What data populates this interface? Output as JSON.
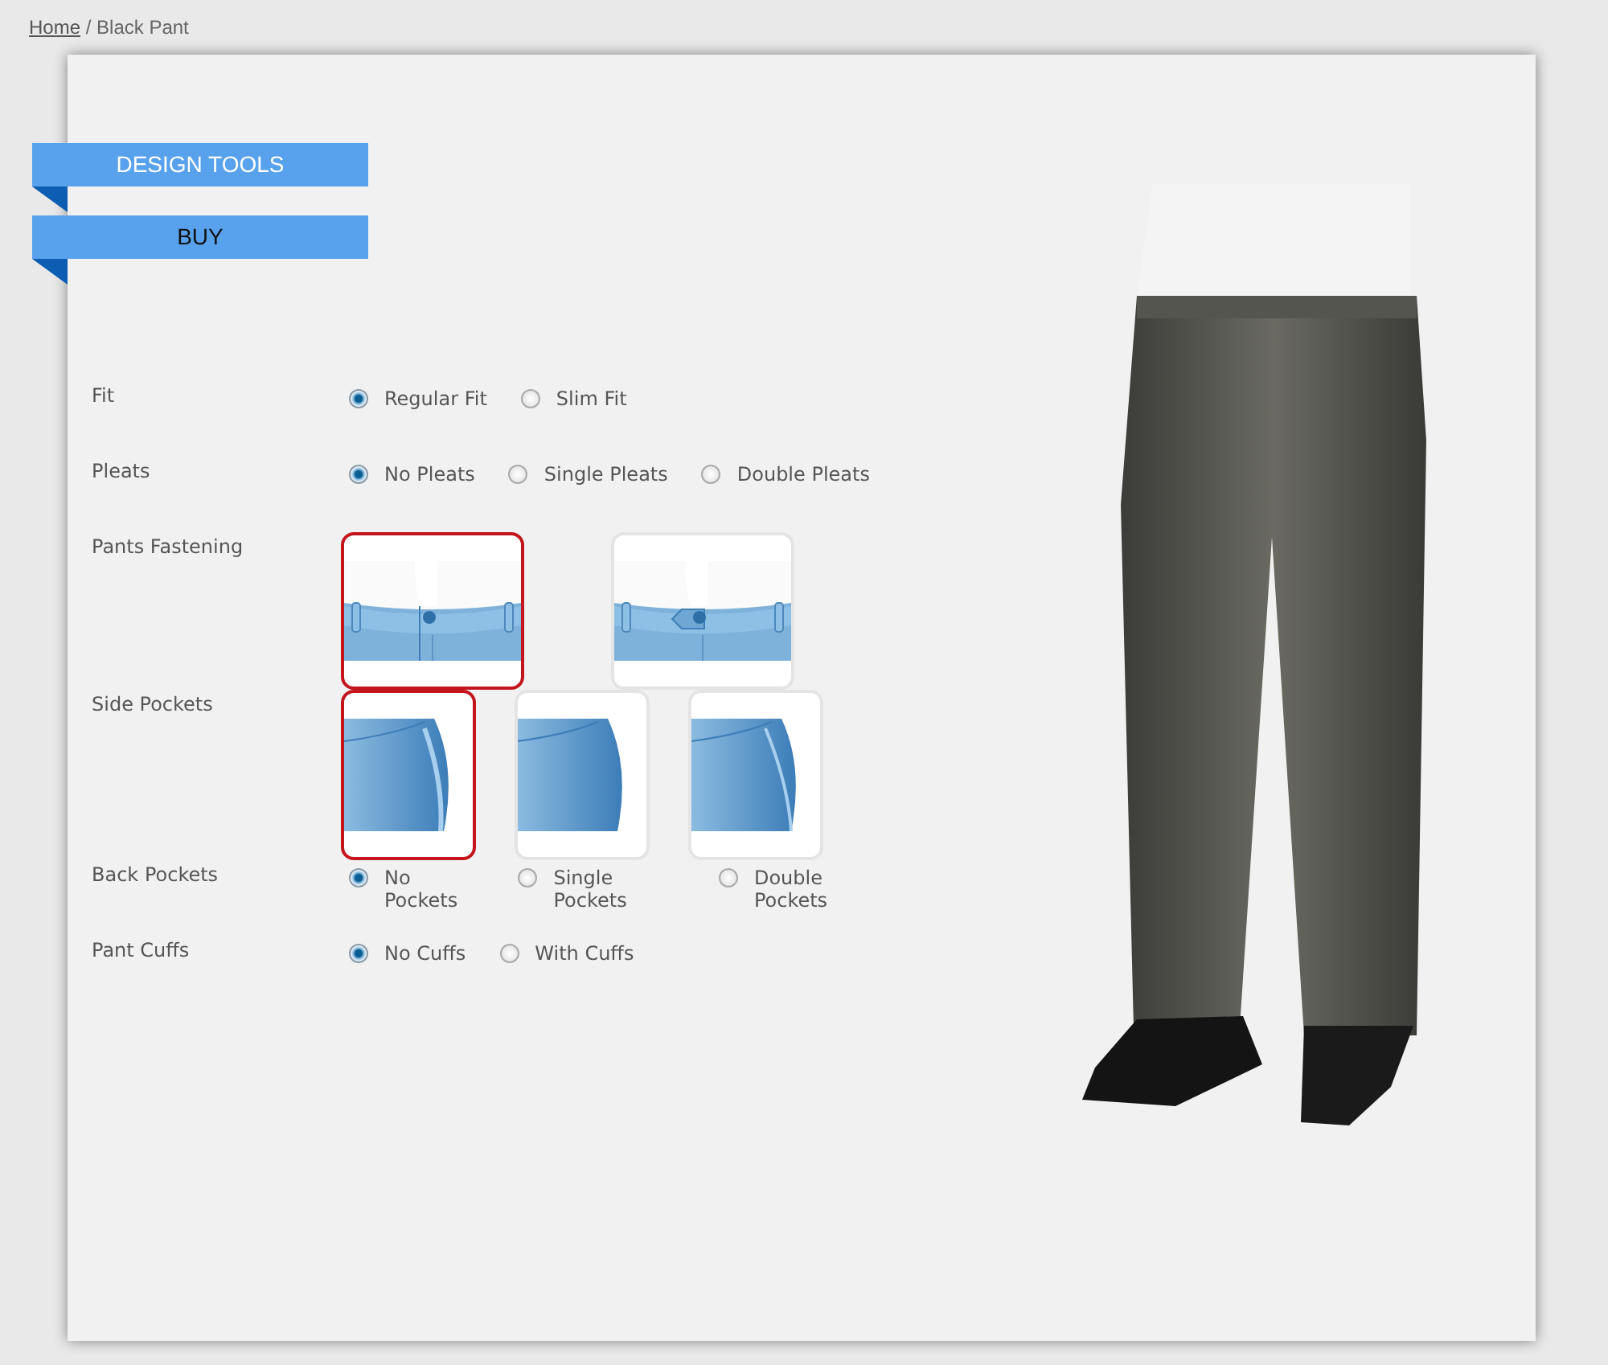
{
  "breadcrumb": {
    "link": "Home",
    "separator": "/",
    "current": "Black Pant"
  },
  "ribbons": [
    {
      "label": "DESIGN TOOLS",
      "selected": true
    },
    {
      "label": "BUY",
      "selected": false
    }
  ],
  "options": [
    {
      "label": "Fit",
      "kind": "radio",
      "choices": [
        {
          "label": "Regular Fit",
          "selected": true
        },
        {
          "label": "Slim Fit",
          "selected": false
        }
      ]
    },
    {
      "label": "Pleats",
      "kind": "radio",
      "choices": [
        {
          "label": "No Pleats",
          "selected": true
        },
        {
          "label": "Single Pleats",
          "selected": false
        },
        {
          "label": "Double Pleats",
          "selected": false
        }
      ]
    },
    {
      "label": "Pants Fastening",
      "kind": "waistband",
      "choices": [
        {
          "selected": true
        },
        {
          "selected": false
        }
      ]
    },
    {
      "label": "Side Pockets",
      "kind": "pocket",
      "choices": [
        {
          "selected": true
        },
        {
          "selected": false
        },
        {
          "selected": false
        }
      ]
    },
    {
      "label": "Back Pockets",
      "kind": "radio",
      "choices": [
        {
          "label": "No Pockets",
          "selected": true
        },
        {
          "label": "Single Pockets",
          "selected": false
        },
        {
          "label": "Double Pockets",
          "selected": false
        }
      ]
    },
    {
      "label": "Pant Cuffs",
      "kind": "radio",
      "choices": [
        {
          "label": "No Cuffs",
          "selected": true
        },
        {
          "label": "With Cuffs",
          "selected": false
        }
      ]
    }
  ]
}
